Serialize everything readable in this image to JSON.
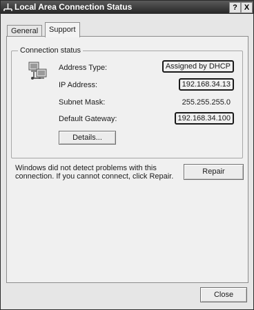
{
  "window": {
    "title": "Local Area Connection Status",
    "help_glyph": "?",
    "close_glyph": "X"
  },
  "tabs": [
    {
      "label": "General",
      "selected": false
    },
    {
      "label": "Support",
      "selected": true
    }
  ],
  "connection_status": {
    "group_label": "Connection status",
    "icon": "network-connection-icon",
    "rows": [
      {
        "label": "Address Type:",
        "value": "Assigned by DHCP",
        "highlighted": true
      },
      {
        "label": "IP Address:",
        "value": "192.168.34.13",
        "highlighted": true
      },
      {
        "label": "Subnet Mask:",
        "value": "255.255.255.0",
        "highlighted": false
      },
      {
        "label": "Default Gateway:",
        "value": "192.168.34.100",
        "highlighted": true
      }
    ],
    "details_button": "Details..."
  },
  "repair_section": {
    "message": "Windows did not detect problems with this connection. If you cannot connect, click Repair.",
    "repair_button": "Repair"
  },
  "footer": {
    "close_button": "Close"
  }
}
